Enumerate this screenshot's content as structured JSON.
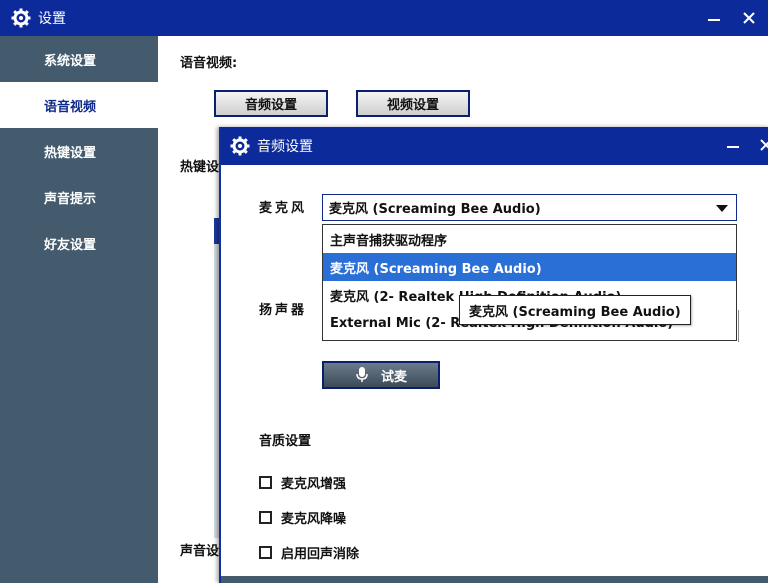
{
  "main_window": {
    "title": "设置",
    "sidebar": [
      {
        "label": "系统设置",
        "active": false
      },
      {
        "label": "语音视频",
        "active": true
      },
      {
        "label": "热键设置",
        "active": false
      },
      {
        "label": "声音提示",
        "active": false
      },
      {
        "label": "好友设置",
        "active": false
      }
    ],
    "content": {
      "section_voice_title": "语音视频:",
      "audio_settings_button": "音频设置",
      "video_settings_button": "视频设置",
      "section_hotkey_title_partial": "热键设",
      "section_sound_title_partial": "声音设"
    }
  },
  "audio_dialog": {
    "title": "音频设置",
    "mic_label": "麦克风",
    "mic_selected": "麦克风 (Screaming Bee Audio)",
    "mic_options": [
      "主声音捕获驱动程序",
      "麦克风 (Screaming Bee Audio)",
      "麦克风 (2- Realtek High Definition Audio)",
      "External Mic (2- Realtek High Definition Audio)"
    ],
    "mic_selected_index": 1,
    "tooltip": "麦克风 (Screaming Bee Audio)",
    "speaker_label": "扬声器",
    "test_button": "试麦",
    "quality_label": "音质设置",
    "checkboxes": [
      {
        "label": "麦克风增强",
        "checked": false
      },
      {
        "label": "麦克风降噪",
        "checked": false
      },
      {
        "label": "启用回声消除",
        "checked": false
      }
    ]
  },
  "colors": {
    "titlebar": "#0d2a9a",
    "sidebar": "#445b6d",
    "selected_option": "#2a6fd6"
  }
}
